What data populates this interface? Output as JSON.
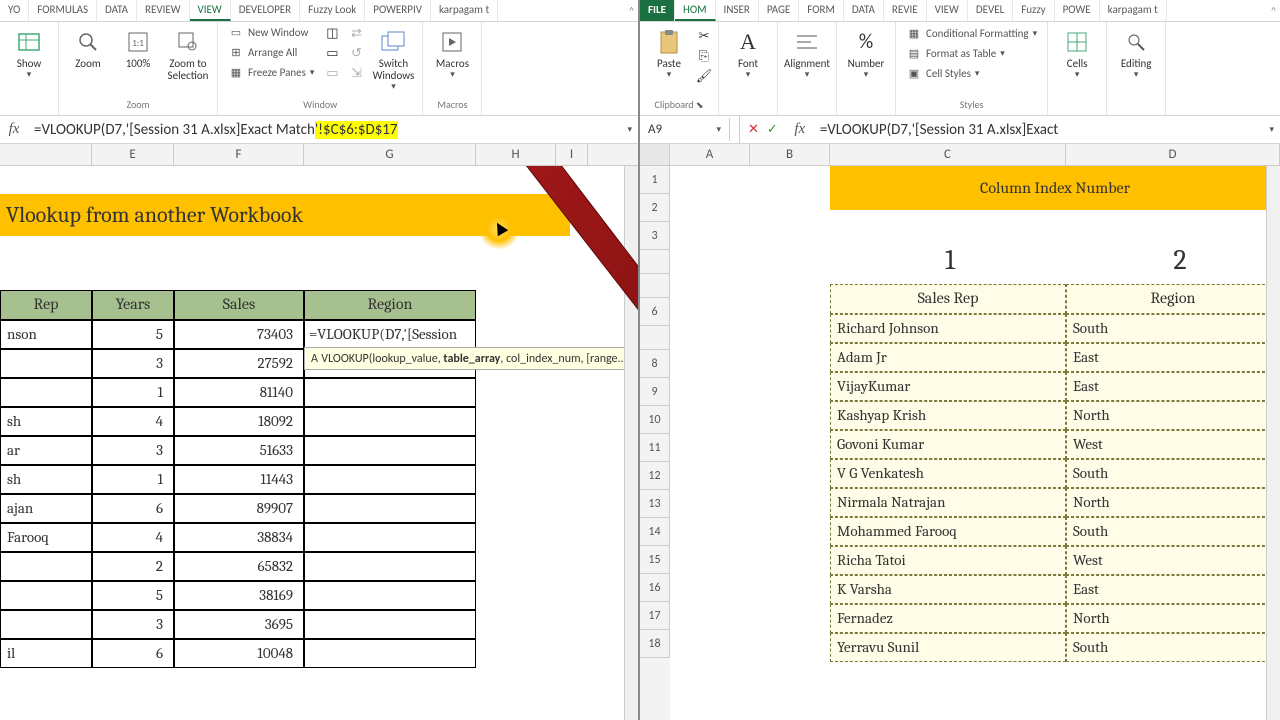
{
  "left": {
    "tabs": [
      "YO",
      "FORMULAS",
      "DATA",
      "REVIEW",
      "VIEW",
      "DEVELOPER",
      "Fuzzy Look",
      "POWERPIV",
      "karpagam t"
    ],
    "activeTab": 4,
    "ribbon": {
      "show": "Show",
      "zoom": "Zoom",
      "zoom100": "100%",
      "zoomsel": "Zoom to\nSelection",
      "zoomLabel": "Zoom",
      "newwin": "New Window",
      "arrange": "Arrange All",
      "freeze": "Freeze Panes",
      "switch": "Switch\nWindows",
      "windowLabel": "Window",
      "macros": "Macros",
      "macrosLabel": "Macros"
    },
    "formula_plain": "=VLOOKUP(D7,'[Session 31 A.xlsx]Exact Match",
    "formula_hl": "'!$C$6:$D$17",
    "cols": {
      "E": "E",
      "F": "F",
      "G": "G",
      "H": "H",
      "I": "I"
    },
    "title": "Vlookup  from another Workbook",
    "headers": {
      "rep": "Rep",
      "years": "Years",
      "sales": "Sales",
      "region": "Region"
    },
    "editcell": "=VLOOKUP(D7,'[Session 31",
    "tooltip": "VLOOKUP(lookup_value, table_array, col_index_num, [range...",
    "tooltip_prefix": "A",
    "rows": [
      {
        "rep": "nson",
        "years": "5",
        "sales": "73403"
      },
      {
        "rep": "",
        "years": "3",
        "sales": "27592"
      },
      {
        "rep": "",
        "years": "1",
        "sales": "81140"
      },
      {
        "rep": "sh",
        "years": "4",
        "sales": "18092"
      },
      {
        "rep": "ar",
        "years": "3",
        "sales": "51633"
      },
      {
        "rep": "sh",
        "years": "1",
        "sales": "11443"
      },
      {
        "rep": "ajan",
        "years": "6",
        "sales": "89907"
      },
      {
        "rep": "Farooq",
        "years": "4",
        "sales": "38834"
      },
      {
        "rep": "",
        "years": "2",
        "sales": "65832"
      },
      {
        "rep": "",
        "years": "5",
        "sales": "38169"
      },
      {
        "rep": "",
        "years": "3",
        "sales": "3695"
      },
      {
        "rep": "il",
        "years": "6",
        "sales": "10048"
      }
    ]
  },
  "right": {
    "tabs": [
      "FILE",
      "HOM",
      "INSER",
      "PAGE",
      "FORM",
      "DATA",
      "REVIE",
      "VIEW",
      "DEVEL",
      "Fuzzy",
      "POWE",
      "karpagam t"
    ],
    "ribbon": {
      "paste": "Paste",
      "clipboard": "Clipboard",
      "font": "Font",
      "alignment": "Alignment",
      "number": "Number",
      "cond": "Conditional Formatting",
      "fmttbl": "Format as Table",
      "cellsty": "Cell Styles",
      "styles": "Styles",
      "cells": "Cells",
      "editing": "Editing"
    },
    "namebox": "A9",
    "formula": "=VLOOKUP(D7,'[Session 31 A.xlsx]Exact",
    "cols": {
      "A": "A",
      "B": "B",
      "C": "C",
      "D": "D"
    },
    "rowN": [
      "1",
      "2",
      "3",
      "",
      "",
      "6",
      "",
      "8",
      "9",
      "10",
      "11",
      "12",
      "13",
      "14",
      "15",
      "16",
      "17",
      "18"
    ],
    "colindex": "Column Index Number",
    "n1": "1",
    "n2": "2",
    "hrep": "Sales Rep",
    "hreg": "Region",
    "data": [
      {
        "rep": "Richard Johnson",
        "reg": "South"
      },
      {
        "rep": "Adam Jr",
        "reg": "East"
      },
      {
        "rep": "VijayKumar",
        "reg": "East"
      },
      {
        "rep": "Kashyap Krish",
        "reg": "North"
      },
      {
        "rep": "Govoni Kumar",
        "reg": "West"
      },
      {
        "rep": "V G Venkatesh",
        "reg": "South"
      },
      {
        "rep": "Nirmala Natrajan",
        "reg": "North"
      },
      {
        "rep": "Mohammed Farooq",
        "reg": "South"
      },
      {
        "rep": "Richa Tatoi",
        "reg": "West"
      },
      {
        "rep": "K Varsha",
        "reg": "East"
      },
      {
        "rep": "Fernadez",
        "reg": "North"
      },
      {
        "rep": "Yerravu Sunil",
        "reg": "South"
      }
    ]
  },
  "chart_data": {
    "type": "table",
    "title": "Vlookup from another Workbook",
    "left_table": {
      "columns": [
        "Rep",
        "Years",
        "Sales",
        "Region"
      ],
      "rows": [
        [
          "nson",
          5,
          73403,
          null
        ],
        [
          "",
          3,
          27592,
          null
        ],
        [
          "",
          1,
          81140,
          null
        ],
        [
          "sh",
          4,
          18092,
          null
        ],
        [
          "ar",
          3,
          51633,
          null
        ],
        [
          "sh",
          1,
          11443,
          null
        ],
        [
          "ajan",
          6,
          89907,
          null
        ],
        [
          "Farooq",
          4,
          38834,
          null
        ],
        [
          "",
          2,
          65832,
          null
        ],
        [
          "",
          5,
          38169,
          null
        ],
        [
          "",
          3,
          3695,
          null
        ],
        [
          "il",
          6,
          10048,
          null
        ]
      ]
    },
    "right_table": {
      "columns": [
        "Sales Rep",
        "Region"
      ],
      "rows": [
        [
          "Richard Johnson",
          "South"
        ],
        [
          "Adam Jr",
          "East"
        ],
        [
          "VijayKumar",
          "East"
        ],
        [
          "Kashyap Krish",
          "North"
        ],
        [
          "Govoni Kumar",
          "West"
        ],
        [
          "V G Venkatesh",
          "South"
        ],
        [
          "Nirmala Natrajan",
          "North"
        ],
        [
          "Mohammed Farooq",
          "South"
        ],
        [
          "Richa Tatoi",
          "West"
        ],
        [
          "K Varsha",
          "East"
        ],
        [
          "Fernadez",
          "North"
        ],
        [
          "Yerravu Sunil",
          "South"
        ]
      ]
    }
  }
}
